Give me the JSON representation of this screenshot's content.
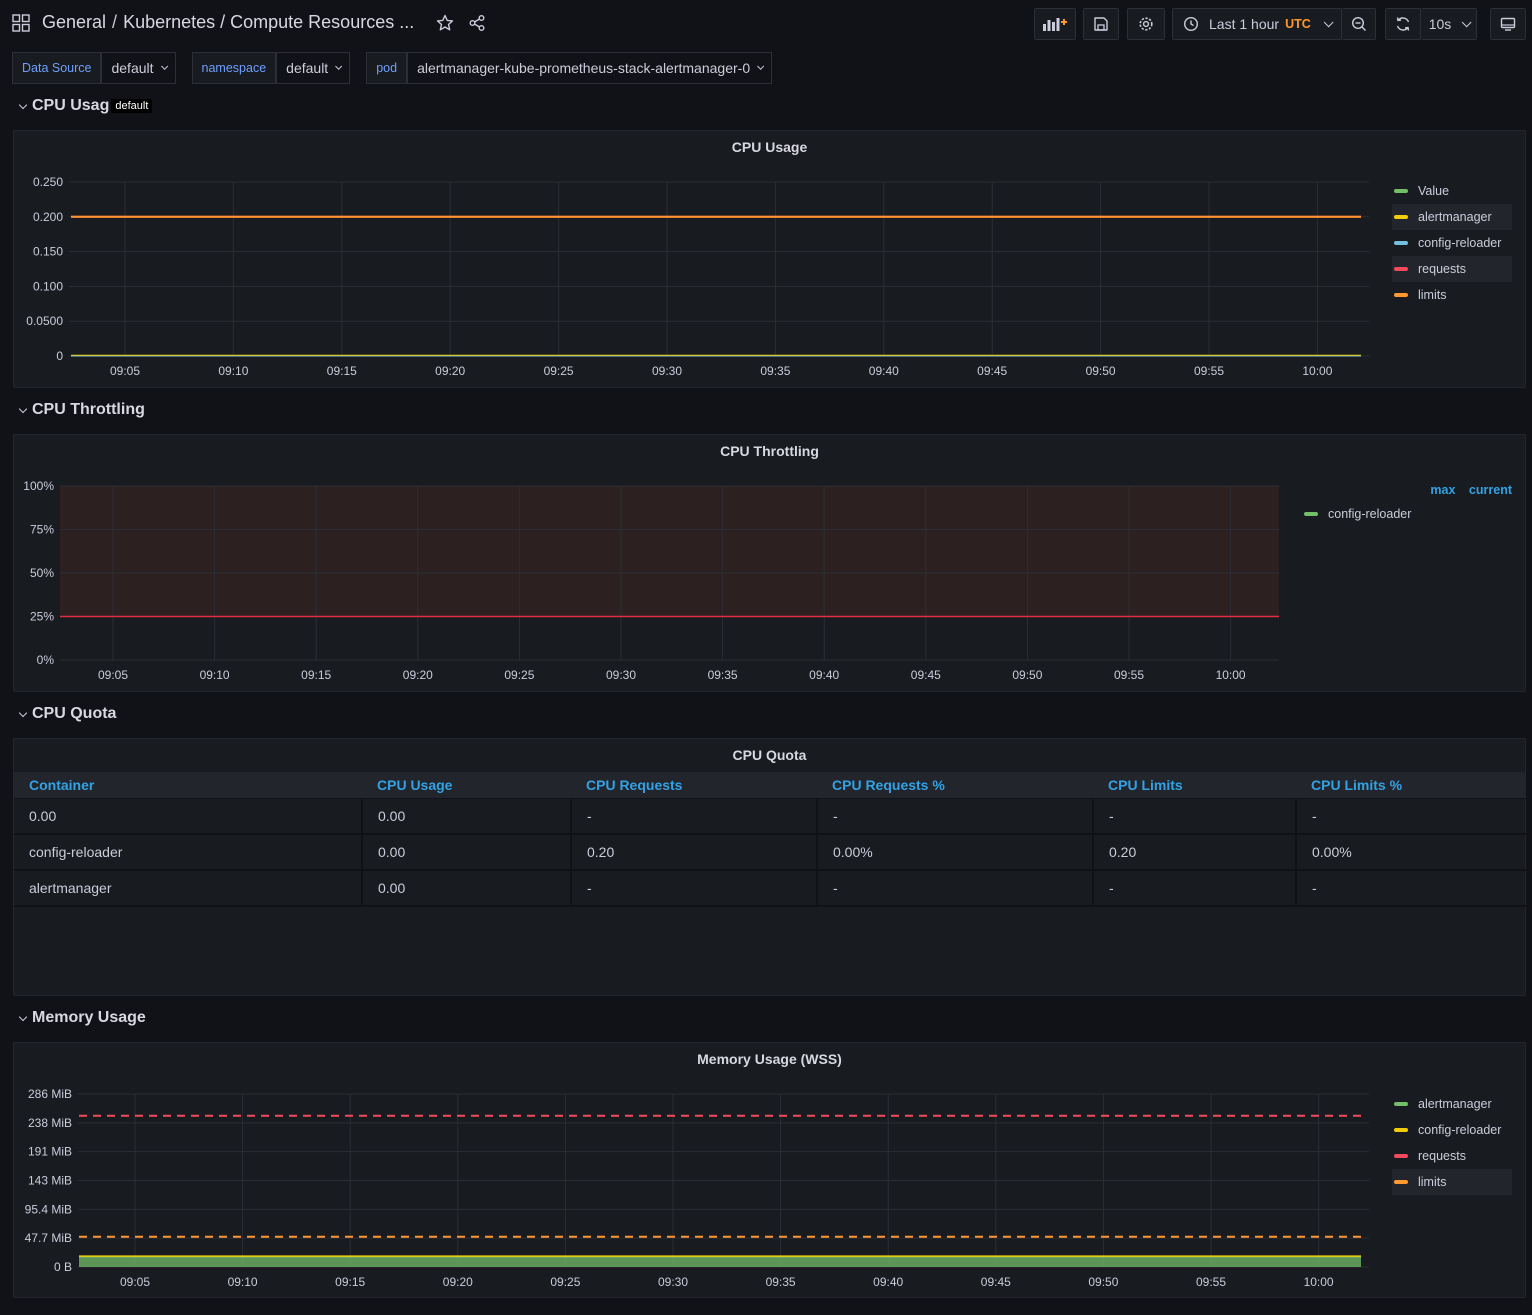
{
  "header": {
    "breadcrumb_root": "General",
    "breadcrumb_sep": "/",
    "breadcrumb_title": "Kubernetes / Compute Resources ...",
    "time_range": "Last 1 hour",
    "timezone": "UTC",
    "refresh_interval": "10s"
  },
  "variables": [
    {
      "label": "Data Source",
      "value": "default"
    },
    {
      "label": "namespace",
      "value": "default"
    },
    {
      "label": "pod",
      "value": "alertmanager-kube-prometheus-stack-alertmanager-0"
    }
  ],
  "rows": {
    "cpu_usage": {
      "title": "CPU Usag",
      "tooltip": "default"
    },
    "cpu_throttling": {
      "title": "CPU Throttling"
    },
    "cpu_quota": {
      "title": "CPU Quota"
    },
    "memory_usage": {
      "title": "Memory Usage"
    }
  },
  "colors": {
    "green": "#73bf69",
    "yellow": "#f2cc0c",
    "blue": "#73c0de",
    "red": "#f2495c",
    "orange": "#ff9830",
    "link": "#33a2e5"
  },
  "x_ticks": [
    "09:05",
    "09:10",
    "09:15",
    "09:20",
    "09:25",
    "09:30",
    "09:35",
    "09:40",
    "09:45",
    "09:50",
    "09:55",
    "10:00"
  ],
  "chart_data": [
    {
      "type": "line",
      "title": "CPU Usage",
      "ylim": [
        0,
        0.25
      ],
      "yticks": [
        "0",
        "0.0500",
        "0.100",
        "0.150",
        "0.200",
        "0.250"
      ],
      "series": [
        {
          "name": "Value",
          "values": [
            0,
            0,
            0,
            0,
            0,
            0,
            0,
            0,
            0,
            0,
            0,
            0
          ]
        },
        {
          "name": "alertmanager",
          "values": [
            0.001,
            0.001,
            0.001,
            0.001,
            0.001,
            0.001,
            0.001,
            0.001,
            0.001,
            0.001,
            0.001,
            0.001
          ]
        },
        {
          "name": "config-reloader",
          "values": [
            0,
            0,
            0,
            0,
            0,
            0,
            0,
            0,
            0,
            0,
            0,
            0
          ]
        },
        {
          "name": "requests",
          "values": [
            0.2,
            0.2,
            0.2,
            0.2,
            0.2,
            0.2,
            0.2,
            0.2,
            0.2,
            0.2,
            0.2,
            0.2
          ]
        },
        {
          "name": "limits",
          "values": [
            0.2,
            0.2,
            0.2,
            0.2,
            0.2,
            0.2,
            0.2,
            0.2,
            0.2,
            0.2,
            0.2,
            0.2
          ]
        }
      ],
      "legend_placement": "right"
    },
    {
      "type": "line",
      "title": "CPU Throttling",
      "ylim": [
        0,
        100
      ],
      "yticks": [
        "0%",
        "25%",
        "50%",
        "75%",
        "100%"
      ],
      "threshold": 25,
      "legend_headers": [
        "max",
        "current"
      ],
      "series": [
        {
          "name": "config-reloader",
          "values": []
        }
      ],
      "legend_placement": "right"
    },
    {
      "type": "table",
      "title": "CPU Quota",
      "columns": [
        "Container",
        "CPU Usage",
        "CPU Requests",
        "CPU Requests %",
        "CPU Limits",
        "CPU Limits %"
      ],
      "rows": [
        [
          "0.00",
          "0.00",
          "-",
          "-",
          "-",
          "-"
        ],
        [
          "config-reloader",
          "0.00",
          "0.20",
          "0.00%",
          "0.20",
          "0.00%"
        ],
        [
          "alertmanager",
          "0.00",
          "-",
          "-",
          "-",
          "-"
        ]
      ]
    },
    {
      "type": "area",
      "title": "Memory Usage (WSS)",
      "yunit": "MiB",
      "ylim": [
        0,
        286
      ],
      "yticks": [
        "0 B",
        "47.7 MiB",
        "95.4 MiB",
        "143 MiB",
        "191 MiB",
        "238 MiB",
        "286 MiB"
      ],
      "series": [
        {
          "name": "alertmanager",
          "values": [
            17,
            17,
            17,
            17,
            17,
            17,
            17,
            17,
            17,
            17,
            17,
            17
          ]
        },
        {
          "name": "config-reloader",
          "values": [
            18,
            18,
            18,
            18,
            18,
            18,
            18,
            18,
            18,
            18,
            18,
            18
          ]
        },
        {
          "name": "requests",
          "values": [
            250,
            250,
            250,
            250,
            250,
            250,
            250,
            250,
            250,
            250,
            250,
            250
          ]
        },
        {
          "name": "limits",
          "values": [
            50,
            50,
            50,
            50,
            50,
            50,
            50,
            50,
            50,
            50,
            50,
            50
          ]
        }
      ],
      "legend_placement": "right"
    }
  ]
}
